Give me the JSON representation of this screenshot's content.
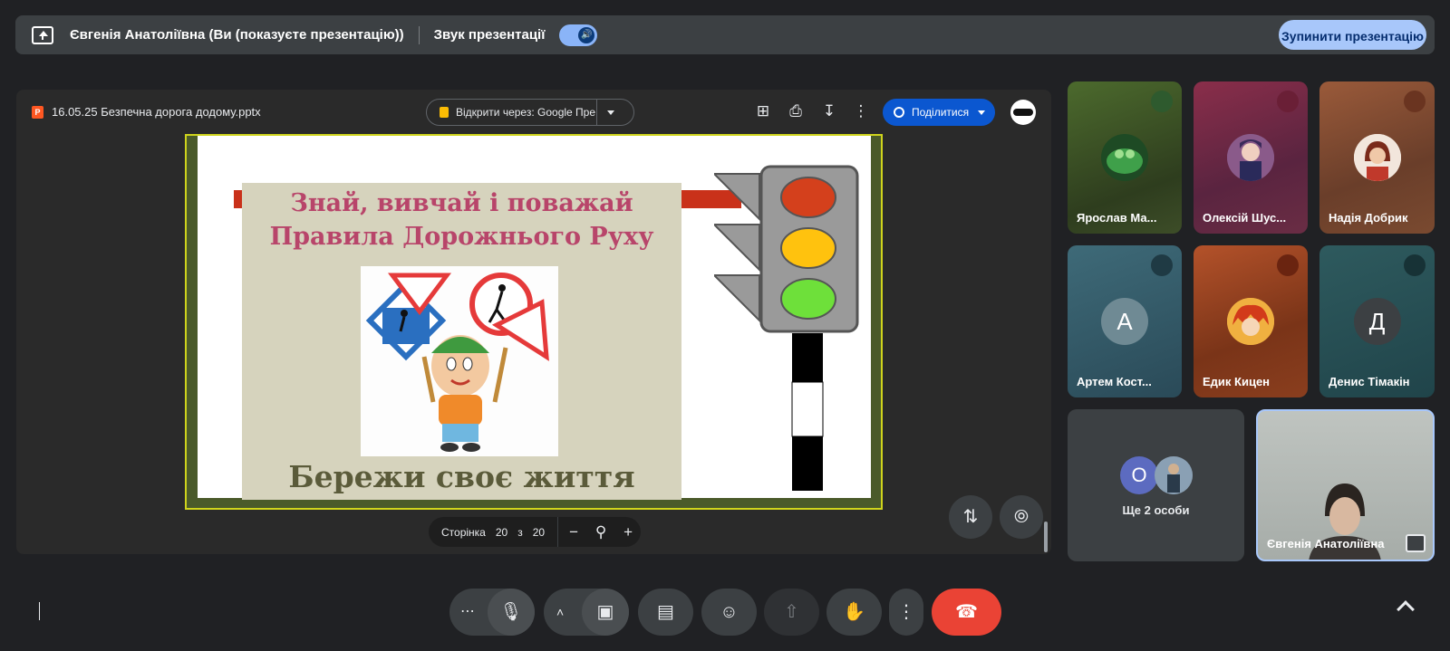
{
  "topbar": {
    "presenter_label": "Євгенія Анатоліївна (Ви (показуєте презентацію))",
    "sound_label": "Звук презентації",
    "sound_on": true,
    "stop_button": "Зупинити презентацію"
  },
  "presentation": {
    "file_name": "16.05.25 Безпечна дорога додому.pptx",
    "file_badge": "P",
    "open_with_label": "Відкрити через: Google Пре...",
    "share_label": "Поділитися",
    "slide": {
      "title_line1": "Знай, вивчай і поважай",
      "title_line2": "Правила Дорожнього Руху",
      "footer": "Бережи своє життя"
    },
    "pager": {
      "page_word": "Сторінка",
      "current": "20",
      "of_word": "з",
      "total": "20"
    }
  },
  "participants": [
    {
      "name": "Ярослав Ма...",
      "muted": true
    },
    {
      "name": "Олексій Шус...",
      "muted": true
    },
    {
      "name": "Надія Добрик",
      "muted": true
    },
    {
      "name": "Артем Кост...",
      "initial": "А",
      "muted": true
    },
    {
      "name": "Едик Кицен",
      "muted": true
    },
    {
      "name": "Денис Тімакін",
      "initial": "Д",
      "muted": true
    }
  ],
  "more_tile": {
    "label": "Ще 2 особи",
    "initial": "О"
  },
  "self_tile": {
    "name": "Євгенія Анатоліївна"
  },
  "colors": {
    "background": "#202124",
    "accent": "#a8c7fa",
    "end_call": "#ea4335",
    "share": "#0b57d0"
  }
}
